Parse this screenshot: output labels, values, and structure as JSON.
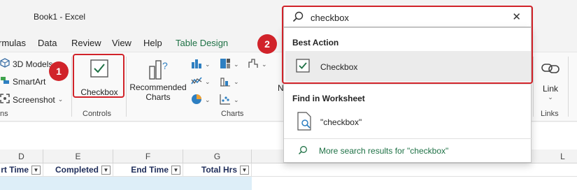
{
  "titlebar": {
    "title": "Book1  -  Excel"
  },
  "menu": {
    "tabs": [
      "rmulas",
      "Data",
      "Review",
      "View",
      "Help",
      "Table Design"
    ]
  },
  "ribbon": {
    "illustrations": {
      "models_label": "3D Models",
      "smartart_label": "SmartArt",
      "screenshot_label": "Screenshot",
      "group_label": "ns"
    },
    "controls": {
      "checkbox_label": "Checkbox",
      "group_label": "Controls"
    },
    "charts": {
      "recommended_label_1": "Recommended",
      "recommended_label_2": "Charts",
      "group_label": "Charts",
      "partial_letter": "N"
    },
    "links": {
      "link_label": "Link",
      "group_label": "Links"
    }
  },
  "search": {
    "value": "checkbox",
    "placeholder": "Search",
    "best_action_title": "Best Action",
    "best_action_item": "Checkbox",
    "worksheet_title": "Find in Worksheet",
    "worksheet_item": "\"checkbox\"",
    "more_results": "More search results for \"checkbox\""
  },
  "callouts": {
    "one": "1",
    "two": "2"
  },
  "sheet": {
    "columns": [
      "D",
      "E",
      "F",
      "G",
      "L"
    ],
    "headers": [
      "rt Time",
      "Completed",
      "End Time",
      "Total Hrs"
    ]
  },
  "colors": {
    "accent_green": "#1e7145",
    "callout_red": "#d1232a",
    "header_text": "#1f2d5a",
    "row_fill": "#ddeef8"
  }
}
